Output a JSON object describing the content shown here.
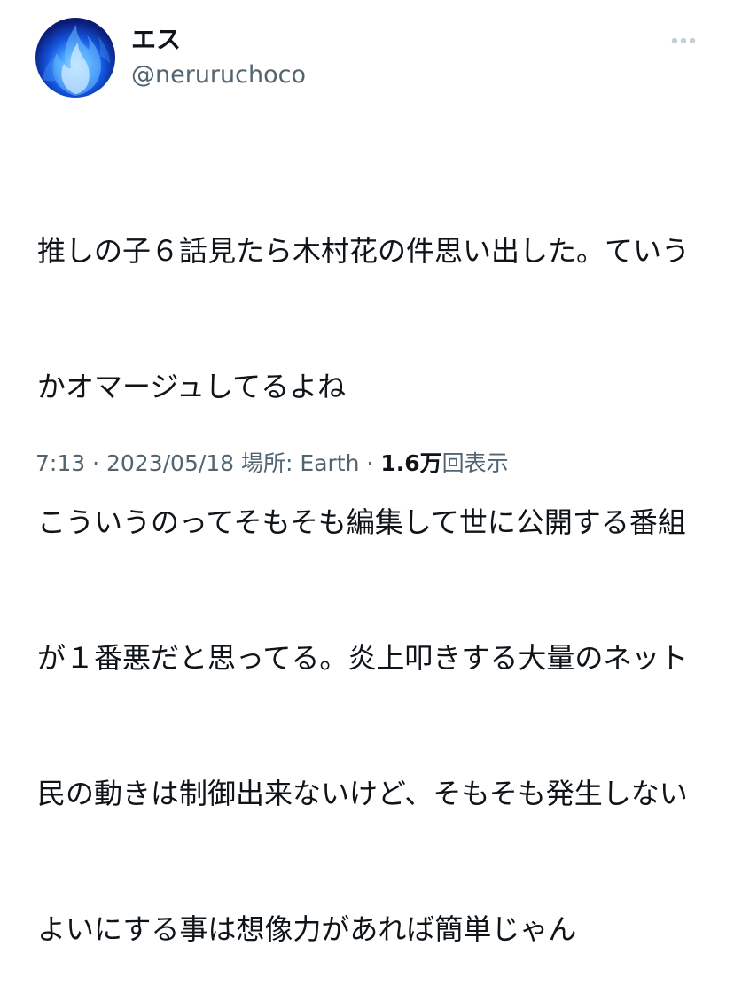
{
  "user": {
    "display_name": "エス",
    "handle": "@neruruchoco",
    "avatar_icon": "blue-flame-avatar"
  },
  "more_icon": "more-horizontal-icon",
  "tweet": {
    "lines": [
      "推しの子６話見たら木村花の件思い出した。ていう",
      "かオマージュしてるよね",
      "こういうのってそもそも編集して世に公開する番組",
      "が１番悪だと思ってる。炎上叩きする大量のネット",
      "民の動きは制御出来ないけど、そもそも発生しない",
      "よいにする事は想像力があれば簡単じゃん"
    ]
  },
  "meta": {
    "time": "7:13",
    "separator": "·",
    "date": "2023/05/18",
    "location_label": "場所: Earth",
    "views_count": "1.6万",
    "views_label": "回表示"
  },
  "colors": {
    "text_primary": "#0f1419",
    "text_secondary": "#536471",
    "icon_gray": "#c4cfd6"
  }
}
